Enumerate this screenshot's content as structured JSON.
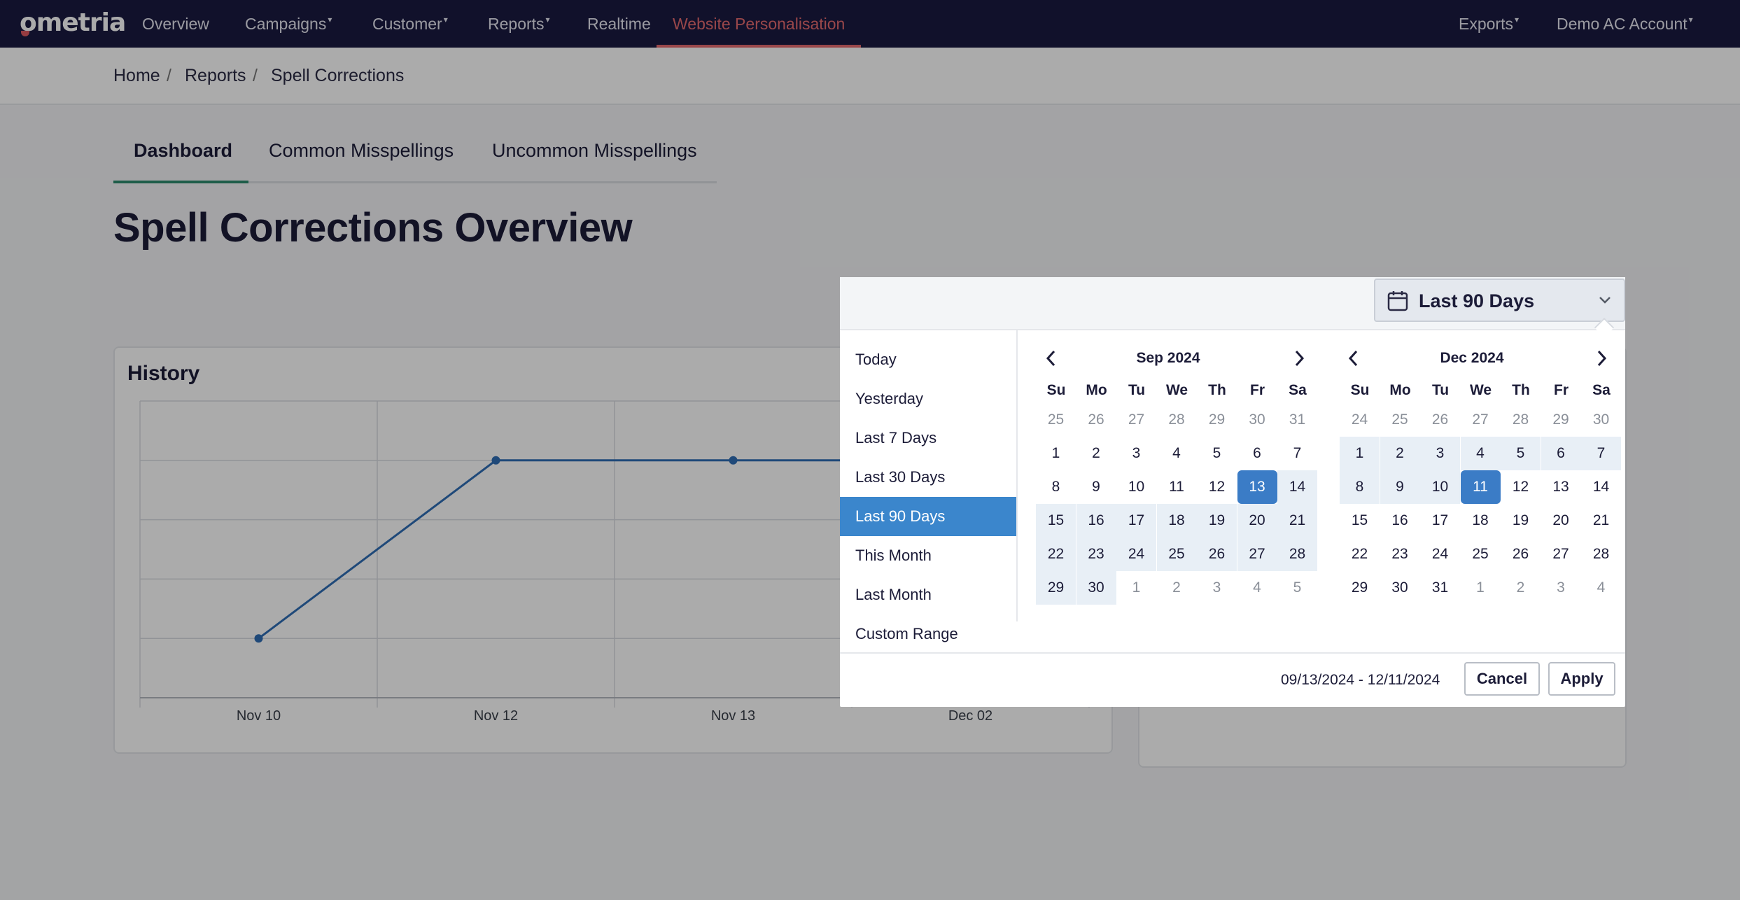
{
  "brand": {
    "logo_text": "ometria"
  },
  "nav": {
    "overview": "Overview",
    "campaigns": "Campaigns",
    "customer": "Customer",
    "reports": "Reports",
    "realtime": "Realtime",
    "website_personalisation": "Website Personalisation",
    "exports": "Exports",
    "account": "Demo AC Account",
    "caret": "▾"
  },
  "breadcrumb": {
    "home": "Home",
    "reports": "Reports",
    "current": "Spell Corrections",
    "sep": "/"
  },
  "tabs": {
    "dashboard": "Dashboard",
    "common": "Common Misspellings",
    "uncommon": "Uncommon Misspellings"
  },
  "page_title": "Spell Corrections Overview",
  "history_card": {
    "title": "History"
  },
  "chart_data": {
    "type": "line",
    "title": "History",
    "categories": [
      "Nov 10",
      "Nov 12",
      "Nov 13",
      "Dec 02"
    ],
    "series": [
      {
        "values": [
          1,
          4,
          4,
          4
        ]
      }
    ],
    "ylim": [
      0,
      5
    ],
    "grid": true,
    "xlabel": "",
    "ylabel": ""
  },
  "picker": {
    "selected_range": "Last 90 Days",
    "presets": [
      "Today",
      "Yesterday",
      "Last 7 Days",
      "Last 30 Days",
      "Last 90 Days",
      "This Month",
      "Last Month",
      "Custom Range"
    ],
    "active_preset": 4,
    "weekdays": [
      "Su",
      "Mo",
      "Tu",
      "We",
      "Th",
      "Fr",
      "Sa"
    ],
    "left_month": {
      "title": "Sep 2024",
      "days": [
        [
          "25",
          "26",
          "27",
          "28",
          "29",
          "30",
          "31"
        ],
        [
          "1",
          "2",
          "3",
          "4",
          "5",
          "6",
          "7"
        ],
        [
          "8",
          "9",
          "10",
          "11",
          "12",
          "13",
          "14"
        ],
        [
          "15",
          "16",
          "17",
          "18",
          "19",
          "20",
          "21"
        ],
        [
          "22",
          "23",
          "24",
          "25",
          "26",
          "27",
          "28"
        ],
        [
          "29",
          "30",
          "1",
          "2",
          "3",
          "4",
          "5"
        ]
      ]
    },
    "right_month": {
      "title": "Dec 2024",
      "days": [
        [
          "24",
          "25",
          "26",
          "27",
          "28",
          "29",
          "30"
        ],
        [
          "1",
          "2",
          "3",
          "4",
          "5",
          "6",
          "7"
        ],
        [
          "8",
          "9",
          "10",
          "11",
          "12",
          "13",
          "14"
        ],
        [
          "15",
          "16",
          "17",
          "18",
          "19",
          "20",
          "21"
        ],
        [
          "22",
          "23",
          "24",
          "25",
          "26",
          "27",
          "28"
        ],
        [
          "29",
          "30",
          "31",
          "1",
          "2",
          "3",
          "4"
        ]
      ]
    },
    "date_range_text": "09/13/2024 - 12/11/2024",
    "cancel_label": "Cancel",
    "apply_label": "Apply"
  }
}
